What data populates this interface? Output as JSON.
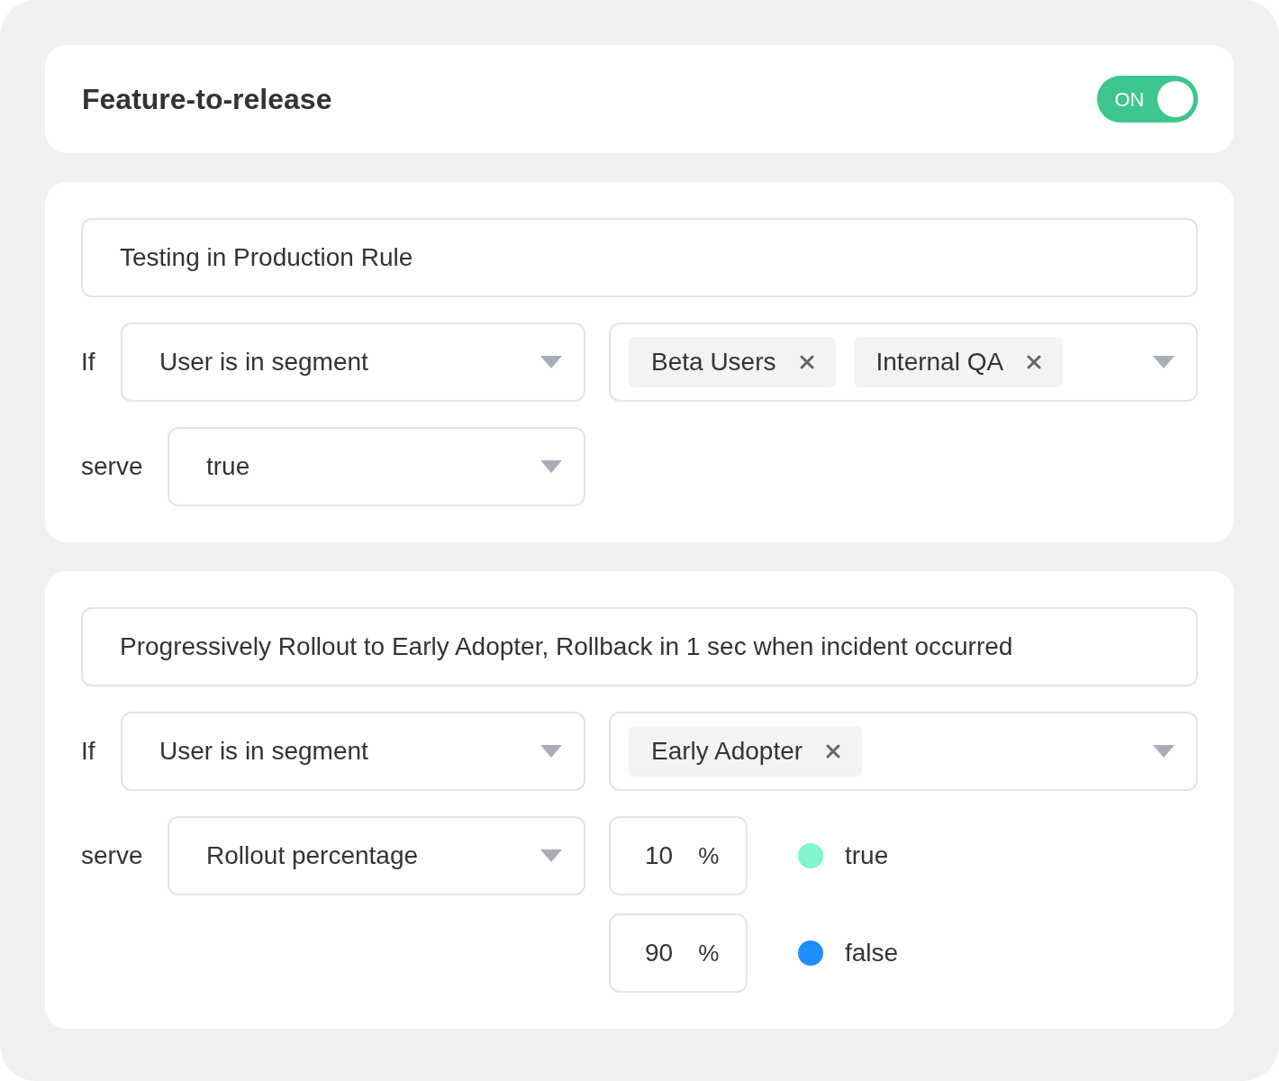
{
  "header": {
    "title": "Feature-to-release",
    "toggle": {
      "label": "ON",
      "on": true
    }
  },
  "rules": [
    {
      "name": "Testing in Production Rule",
      "condition": {
        "label": "If",
        "operator": "User is in segment",
        "tags": [
          "Beta Users",
          "Internal QA"
        ]
      },
      "serve": {
        "label": "serve",
        "value": "true"
      }
    },
    {
      "name": "Progressively Rollout to Early Adopter, Rollback in 1 sec when incident occurred",
      "condition": {
        "label": "If",
        "operator": "User is in segment",
        "tags": [
          "Early Adopter"
        ]
      },
      "serve": {
        "label": "serve",
        "value": "Rollout percentage",
        "splits": [
          {
            "percent": "10",
            "unit": "%",
            "variant": "true",
            "color": "#7ff5d0"
          },
          {
            "percent": "90",
            "unit": "%",
            "variant": "false",
            "color": "#1e8ffc"
          }
        ]
      }
    }
  ]
}
